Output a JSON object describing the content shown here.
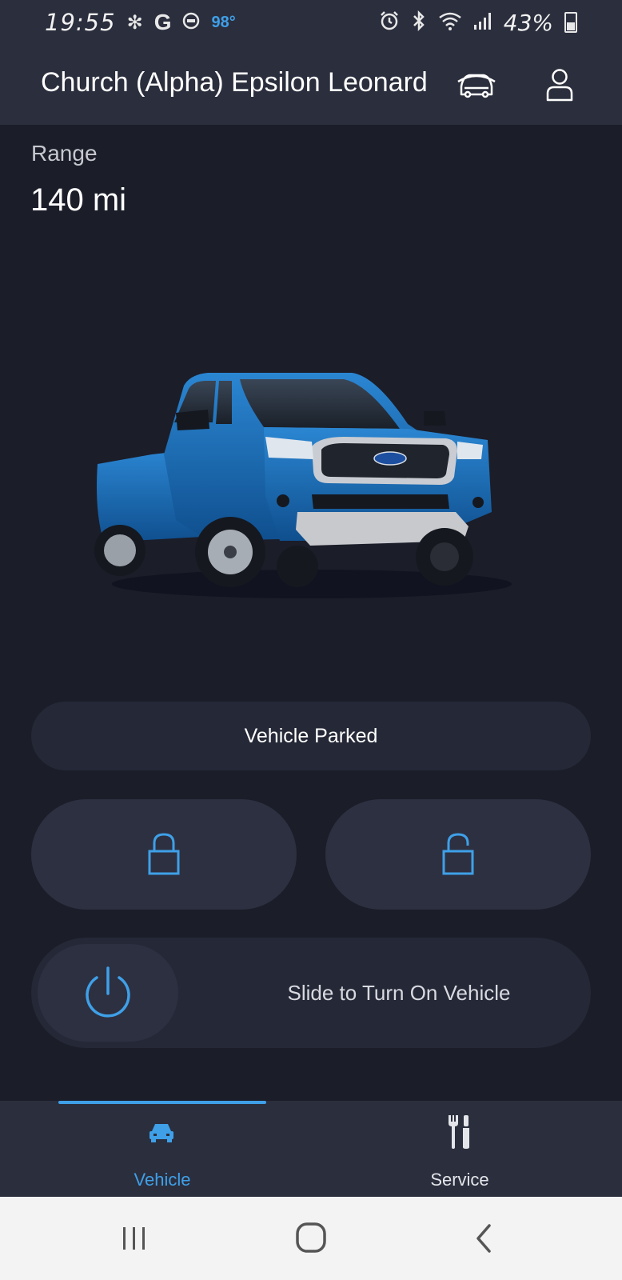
{
  "status_bar": {
    "time": "19:55",
    "g_label": "G",
    "temperature": "98°",
    "battery_percent": "43%",
    "icons": [
      "fan-icon",
      "g-app-icon",
      "shield-icon",
      "alarm-icon",
      "bluetooth-icon",
      "wifi-icon",
      "signal-icon",
      "battery-icon"
    ]
  },
  "header": {
    "title": "Church (Alpha) Epsilon Leonard",
    "car_icon": "vehicle-select-icon",
    "user_icon": "account-icon"
  },
  "range": {
    "label": "Range",
    "value": "140  mi"
  },
  "vehicle": {
    "image": "blue-pickup-truck",
    "color": "#1f6fb8"
  },
  "status": {
    "parked_label": "Vehicle Parked"
  },
  "controls": {
    "lock_icon": "lock-icon",
    "unlock_icon": "unlock-icon",
    "start_icon": "power-icon",
    "slide_label": "Slide to Turn On Vehicle"
  },
  "bottom_nav": {
    "tabs": [
      {
        "label": "Vehicle",
        "icon": "car-icon",
        "active": true
      },
      {
        "label": "Service",
        "icon": "tools-icon",
        "active": false
      }
    ]
  },
  "colors": {
    "accent": "#3fa0e8",
    "background": "#1b1d29",
    "surface": "#2b2e3d"
  }
}
